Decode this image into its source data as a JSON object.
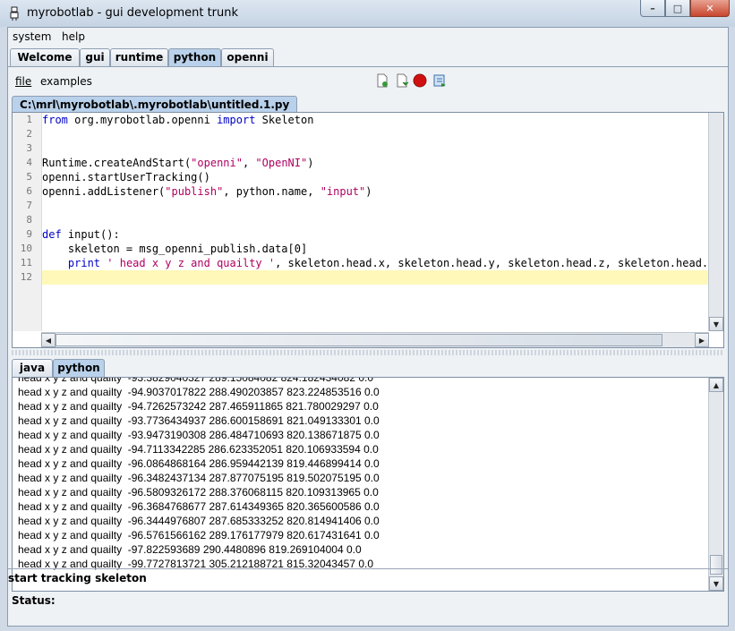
{
  "window": {
    "title": "myrobotlab - gui development trunk"
  },
  "menu": {
    "system": "system",
    "help": "help"
  },
  "main_tabs": [
    {
      "label": "Welcome"
    },
    {
      "label": "gui"
    },
    {
      "label": "runtime"
    },
    {
      "label": "python"
    },
    {
      "label": "openni"
    }
  ],
  "python_menu": {
    "file": "file",
    "examples": "examples"
  },
  "toolbar": {
    "icons": [
      "new-file-icon",
      "open-file-icon",
      "stop-icon",
      "execute-icon"
    ],
    "colors": {
      "stop": "#d01010",
      "new": "#3a9a3a"
    }
  },
  "editor": {
    "file_tab": "C:\\mrl\\myrobotlab\\.myrobotlab\\untitled.1.py",
    "line_numbers": [
      "1",
      "2",
      "3",
      "4",
      "5",
      "6",
      "7",
      "8",
      "9",
      "10",
      "11",
      "12"
    ],
    "current_line": 12
  },
  "bottom_tabs": [
    {
      "label": "java"
    },
    {
      "label": "python"
    }
  ],
  "console": {
    "lines": [
      "head x y z and quailty  -93.3829040327 289.15084082 824.182434082 0.0",
      "head x y z and quailty  -94.9037017822 288.490203857 823.224853516 0.0",
      "head x y z and quailty  -94.7262573242 287.465911865 821.780029297 0.0",
      "head x y z and quailty  -93.7736434937 286.600158691 821.049133301 0.0",
      "head x y z and quailty  -93.9473190308 286.484710693 820.138671875 0.0",
      "head x y z and quailty  -94.7113342285 286.623352051 820.106933594 0.0",
      "head x y z and quailty  -96.0864868164 286.959442139 819.446899414 0.0",
      "head x y z and quailty  -96.3482437134 287.877075195 819.502075195 0.0",
      "head x y z and quailty  -96.5809326172 288.376068115 820.109313965 0.0",
      "head x y z and quailty  -96.3684768677 287.614349365 820.365600586 0.0",
      "head x y z and quailty  -96.3444976807 287.685333252 820.814941406 0.0",
      "head x y z and quailty  -96.5761566162 289.176177979 820.617431641 0.0",
      "head x y z and quailty  -97.822593689 290.4480896 819.269104004 0.0",
      "head x y z and quailty  -99.7727813721 305.212188721 815.32043457 0.0"
    ]
  },
  "status": {
    "label": "Status:",
    "text": "start tracking skeleton"
  }
}
